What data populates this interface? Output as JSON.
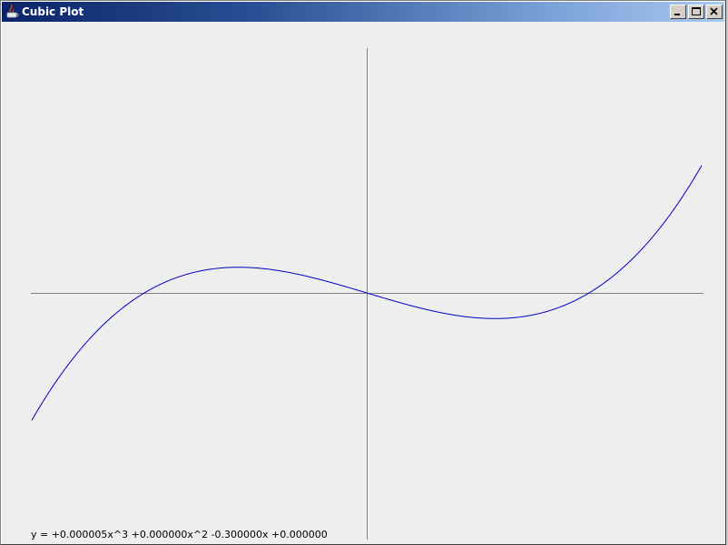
{
  "window": {
    "title": "Cubic Plot",
    "controls": {
      "minimize_icon": "minimize-icon",
      "maximize_icon": "maximize-icon",
      "close_icon": "close-icon"
    }
  },
  "plot": {
    "equation_label": "y = +0.000005x^3 +0.000000x^2 -0.300000x +0.000000",
    "coefficients": {
      "a": 5e-06,
      "b": 0.0,
      "c": -0.3,
      "d": 0.0
    },
    "axes_color": "#808080",
    "curve_color": "#0000c0"
  },
  "chart_data": {
    "type": "line",
    "function": "cubic",
    "coefficients": {
      "a": 5e-06,
      "b": 0.0,
      "c": -0.3,
      "d": 0.0
    },
    "xlim": [
      -370,
      370
    ],
    "ylim": [
      -270,
      270
    ],
    "grid": false,
    "series": [
      {
        "color": "#0000c0"
      }
    ]
  }
}
